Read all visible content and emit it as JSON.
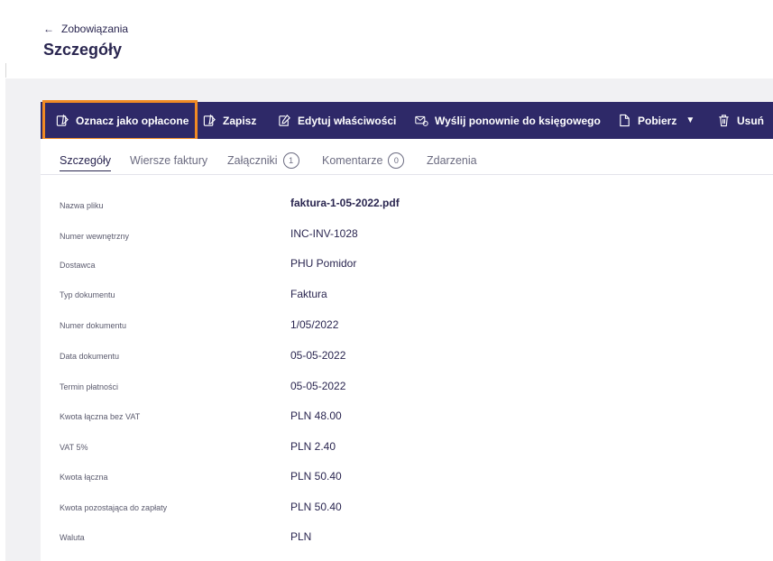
{
  "header": {
    "back_label": "Zobowiązania",
    "title": "Szczegóły"
  },
  "toolbar": {
    "mark_paid": "Oznacz jako opłacone",
    "save": "Zapisz",
    "edit_props": "Edytuj właściwości",
    "resend": "Wyślij ponownie do księgowego",
    "download": "Pobierz",
    "delete": "Usuń",
    "highlight_color": "#f08a24",
    "bar_color": "#2e2968"
  },
  "tabs": {
    "details": "Szczegóły",
    "invoice_lines": "Wiersze faktury",
    "attachments": "Załączniki",
    "attachments_count": "1",
    "comments": "Komentarze",
    "comments_count": "0",
    "events": "Zdarzenia"
  },
  "details": [
    {
      "label": "Nazwa pliku",
      "value": "faktura-1-05-2022.pdf"
    },
    {
      "label": "Numer wewnętrzny",
      "value": "INC-INV-1028"
    },
    {
      "label": "Dostawca",
      "value": "PHU Pomidor"
    },
    {
      "label": "Typ dokumentu",
      "value": "Faktura"
    },
    {
      "label": "Numer dokumentu",
      "value": "1/05/2022"
    },
    {
      "label": "Data dokumentu",
      "value": "05-05-2022"
    },
    {
      "label": "Termin płatności",
      "value": "05-05-2022"
    },
    {
      "label": "Kwota łączna bez VAT",
      "value": "PLN 48.00"
    },
    {
      "label": "VAT 5%",
      "value": "PLN 2.40"
    },
    {
      "label": "Kwota łączna",
      "value": "PLN 50.40"
    },
    {
      "label": "Kwota pozostająca do zapłaty",
      "value": "PLN 50.40"
    },
    {
      "label": "Waluta",
      "value": "PLN"
    }
  ]
}
